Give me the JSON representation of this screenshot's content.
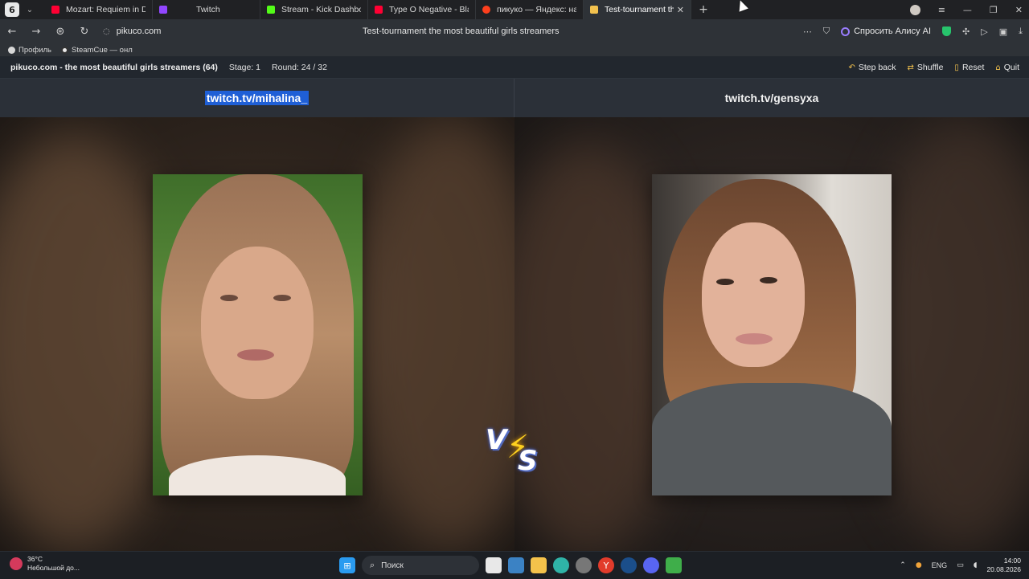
{
  "browser": {
    "tab_count": "6",
    "tabs": [
      {
        "title": "Mozart: Requiem in D Minor",
        "fav_color": "#ff0033"
      },
      {
        "title": "Twitch",
        "fav_color": "#9146ff"
      },
      {
        "title": "Stream - Kick Dashboard",
        "fav_color": "#53fc18"
      },
      {
        "title": "Type O Negative - Black N",
        "fav_color": "#ff0033"
      },
      {
        "title": "пикуко — Яндекс: нашлос",
        "fav_color": "#fc3f1d"
      },
      {
        "title": "Test-tournament the m",
        "fav_color": "#f2c14e",
        "active": true
      }
    ],
    "new_tab": "+",
    "url": "pikuco.com",
    "page_title": "Test-tournament the most beautiful girls streamers",
    "alice_label": "Спросить Алису AI",
    "bookmarks": [
      "Профиль",
      "SteamCue — онл"
    ]
  },
  "site": {
    "name": "pikuco.com - the most beautiful girls streamers (64)",
    "stage": "Stage: 1",
    "round": "Round: 24 / 32",
    "actions": [
      {
        "label": "Step back",
        "icon": "↶"
      },
      {
        "label": "Shuffle",
        "icon": "⇄"
      },
      {
        "label": "Reset",
        "icon": "▯"
      },
      {
        "label": "Quit",
        "icon": "⌂"
      }
    ]
  },
  "contestants": {
    "left": "twitch.tv/mihalina_",
    "right": "twitch.tv/gensyxa"
  },
  "vs": {
    "v": "V",
    "s": "S",
    "bolt": "⚡"
  },
  "taskbar": {
    "weather_temp": "36°C",
    "weather_desc": "Небольшой до...",
    "search_placeholder": "Поиск",
    "lang": "ENG",
    "time": "14:00",
    "date": "20.08.2026"
  }
}
